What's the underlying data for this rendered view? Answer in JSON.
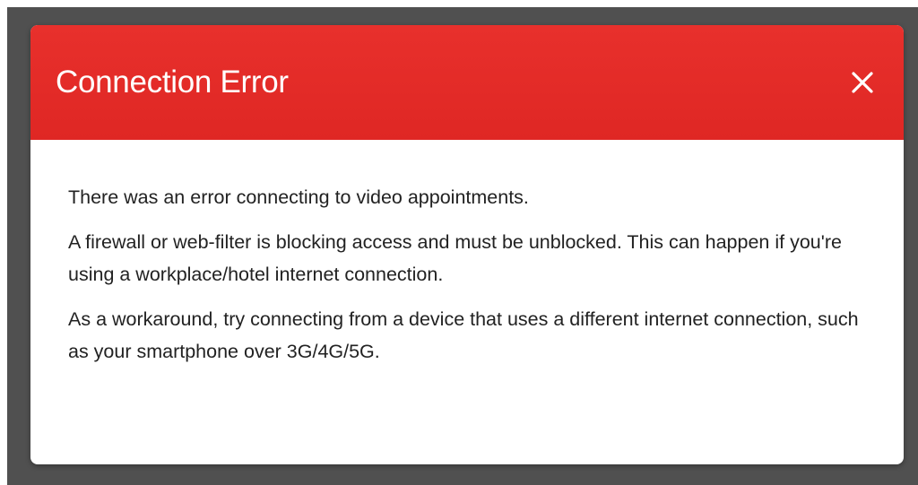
{
  "dialog": {
    "title": "Connection Error",
    "close_icon": "close-icon",
    "paragraphs": {
      "p1": "There was an error connecting to video appointments.",
      "p2": "A firewall or web-filter is blocking access and must be unblocked. This can happen if you're using a workplace/hotel internet connection.",
      "p3": "As a workaround, try connecting from a device that uses a different internet connection, such as your smartphone over 3G/4G/5G."
    }
  },
  "colors": {
    "header": "#e22a27",
    "backdrop": "#505050",
    "title_text": "#ffffff",
    "body_text": "#222222"
  }
}
